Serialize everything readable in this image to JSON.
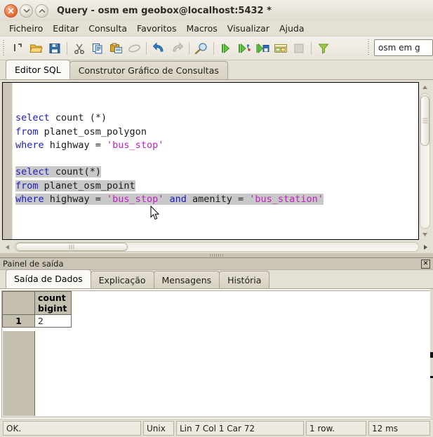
{
  "window": {
    "title": "Query - osm em geobox@localhost:5432 *",
    "controls": [
      {
        "name": "close",
        "glyph": "✕"
      },
      {
        "name": "minimize",
        "glyph": "▾"
      },
      {
        "name": "maximize",
        "glyph": "▴"
      }
    ]
  },
  "menubar": {
    "items": [
      {
        "label": "Ficheiro"
      },
      {
        "label": "Editar"
      },
      {
        "label": "Consulta"
      },
      {
        "label": "Favoritos"
      },
      {
        "label": "Macros"
      },
      {
        "label": "Visualizar"
      },
      {
        "label": "Ajuda"
      }
    ]
  },
  "toolbar": {
    "buttons": [
      {
        "name": "new-query-icon",
        "icon": "new-file"
      },
      {
        "name": "open-file-icon",
        "icon": "open-folder"
      },
      {
        "name": "save-file-icon",
        "icon": "floppy-save"
      },
      {
        "name": "cut-icon",
        "icon": "scissors"
      },
      {
        "name": "copy-icon",
        "icon": "copy"
      },
      {
        "name": "paste-icon",
        "icon": "paste"
      },
      {
        "name": "clear-window-icon",
        "icon": "eraser"
      },
      {
        "name": "undo-icon",
        "icon": "undo-arrow"
      },
      {
        "name": "redo-icon",
        "icon": "redo-arrow"
      },
      {
        "name": "find-replace-icon",
        "icon": "magnifier"
      },
      {
        "name": "execute-query-icon",
        "icon": "play-green"
      },
      {
        "name": "explain-query-icon",
        "icon": "play-explain"
      },
      {
        "name": "execute-to-file-icon",
        "icon": "play-to-file"
      },
      {
        "name": "query-builder-icon",
        "icon": "builder"
      },
      {
        "name": "cancel-query-icon",
        "icon": "stop-square"
      },
      {
        "name": "filter-icon",
        "icon": "funnel-green"
      }
    ],
    "connection": {
      "value": "osm em g",
      "placeholder": "osm em geobox@localhost:5432"
    }
  },
  "editor_tabs": {
    "items": [
      {
        "label": "Editor SQL",
        "active": true
      },
      {
        "label": "Construtor Gráfico de Consultas",
        "active": false
      }
    ]
  },
  "sql": {
    "lines": [
      {
        "selected": false,
        "tokens": []
      },
      {
        "selected": false,
        "tokens": [
          {
            "t": "select",
            "c": "kw"
          },
          {
            "t": " ",
            "c": "id"
          },
          {
            "t": "count",
            "c": "id"
          },
          {
            "t": " (*)",
            "c": "id"
          }
        ]
      },
      {
        "selected": false,
        "tokens": [
          {
            "t": "from",
            "c": "kw"
          },
          {
            "t": " planet_osm_polygon",
            "c": "id"
          }
        ]
      },
      {
        "selected": false,
        "tokens": [
          {
            "t": "where",
            "c": "kw"
          },
          {
            "t": " highway = ",
            "c": "id"
          },
          {
            "t": "'bus_stop'",
            "c": "str"
          }
        ]
      },
      {
        "selected": false,
        "tokens": []
      },
      {
        "selected": true,
        "tokens": [
          {
            "t": "select",
            "c": "kw"
          },
          {
            "t": " ",
            "c": "id"
          },
          {
            "t": "count(*)",
            "c": "id"
          }
        ]
      },
      {
        "selected": true,
        "tokens": [
          {
            "t": "from",
            "c": "kw"
          },
          {
            "t": " planet_osm_point",
            "c": "id"
          }
        ]
      },
      {
        "selected": true,
        "tokens": [
          {
            "t": "where",
            "c": "kw"
          },
          {
            "t": " highway = ",
            "c": "id"
          },
          {
            "t": "'bus_stop'",
            "c": "str"
          },
          {
            "t": " ",
            "c": "id"
          },
          {
            "t": "and",
            "c": "kw"
          },
          {
            "t": " amenity = ",
            "c": "id"
          },
          {
            "t": "'bus_station'",
            "c": "str"
          }
        ]
      }
    ]
  },
  "output_panel": {
    "title": "Painel de saída",
    "close_glyph": "✕",
    "tabs": [
      {
        "label": "Saída de Dados",
        "active": true
      },
      {
        "label": "Explicação",
        "active": false
      },
      {
        "label": "Mensagens",
        "active": false
      },
      {
        "label": "História",
        "active": false
      }
    ],
    "grid": {
      "columns": [
        {
          "name": "count",
          "type": "bigint"
        }
      ],
      "rows": [
        {
          "num": "1",
          "cells": [
            "2"
          ]
        }
      ]
    }
  },
  "statusbar": {
    "message": "OK.",
    "line_ending": "Unix",
    "position": "Lin 7 Col 1 Car 72",
    "rows": "1 row.",
    "duration": "12 ms"
  },
  "colors": {
    "keyword": "#1a1ac0",
    "string": "#c020c0",
    "selection": "#c8c8c8",
    "chrome": "#e4e0d4",
    "grid_header": "#c4bfae"
  }
}
